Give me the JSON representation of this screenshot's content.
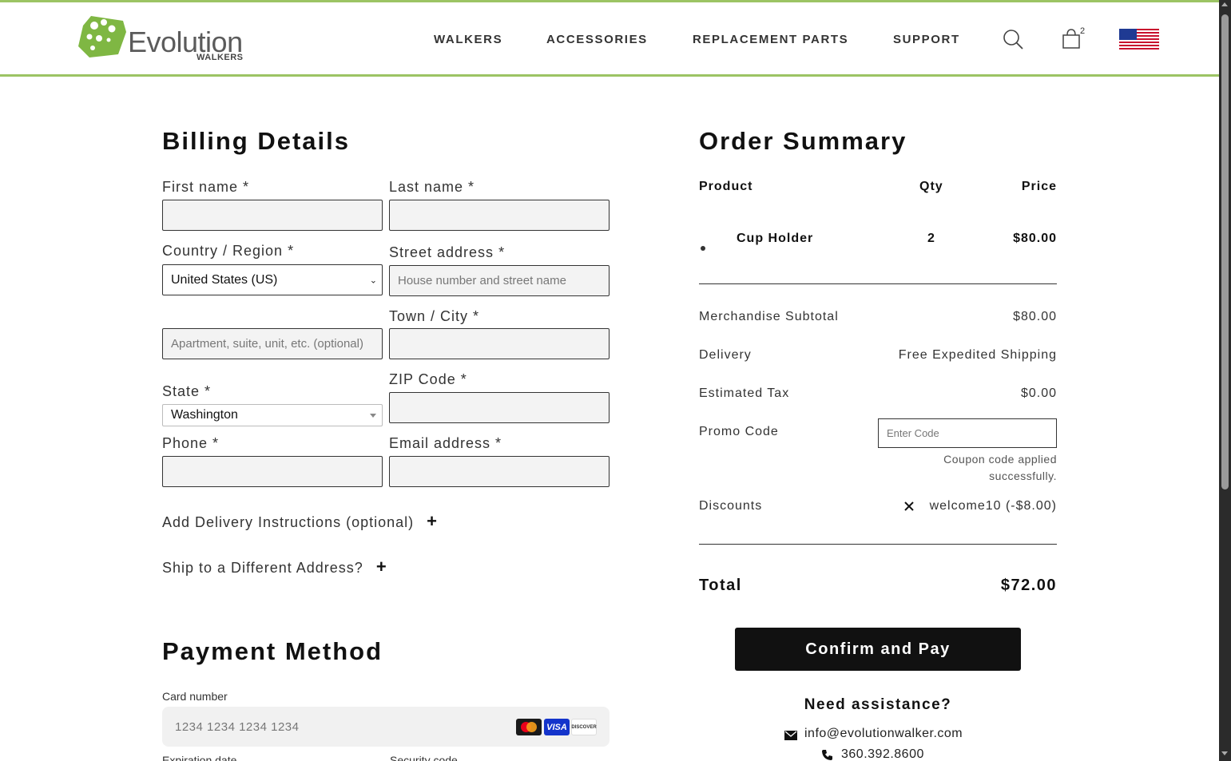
{
  "brand": {
    "name": "Evolution",
    "subtitle": "WALKERS",
    "accent_color": "#9cc464"
  },
  "nav": {
    "items": [
      "WALKERS",
      "ACCESSORIES",
      "REPLACEMENT PARTS",
      "SUPPORT"
    ],
    "cart_count": "2",
    "search_icon": "search-icon",
    "cart_icon": "shopping-bag-icon",
    "flag_icon": "us-flag-icon"
  },
  "billing": {
    "title": "Billing Details",
    "first_name_label": "First name *",
    "last_name_label": "Last name *",
    "country_label": "Country / Region *",
    "country_value": "United States (US)",
    "street_label": "Street address *",
    "street_placeholder": "House number and street name",
    "apt_placeholder": "Apartment, suite, unit, etc. (optional)",
    "city_label": "Town / City *",
    "state_label": "State *",
    "state_value": "Washington",
    "zip_label": "ZIP Code *",
    "phone_label": "Phone *",
    "email_label": "Email address *",
    "delivery_instructions": "Add Delivery Instructions (optional)",
    "ship_different": "Ship to a Different Address?"
  },
  "payment": {
    "title": "Payment Method",
    "card_label": "Card number",
    "card_placeholder": "1234 1234 1234 1234",
    "card_brands": [
      "mastercard-icon",
      "visa-icon",
      "discover-icon"
    ],
    "visa_text": "VISA",
    "discover_text": "DISCOVER",
    "expiry_label": "Expiration date",
    "cvc_label": "Security code"
  },
  "summary": {
    "title": "Order Summary",
    "headers": {
      "product": "Product",
      "qty": "Qty",
      "price": "Price"
    },
    "items": [
      {
        "name": "Cup Holder",
        "qty": "2",
        "price": "$80.00"
      }
    ],
    "subtotal_label": "Merchandise Subtotal",
    "subtotal_value": "$80.00",
    "delivery_label": "Delivery",
    "delivery_value": "Free Expedited Shipping",
    "tax_label": "Estimated Tax",
    "tax_value": "$0.00",
    "promo_label": "Promo Code",
    "promo_placeholder": "Enter Code",
    "coupon_msg_1": "Coupon code applied",
    "coupon_msg_2": "successfully.",
    "discounts_label": "Discounts",
    "discount_value": "welcome10 (-$8.00)",
    "total_label": "Total",
    "total_value": "$72.00",
    "confirm_label": "Confirm and Pay",
    "need_help": "Need assistance?",
    "email": "info@evolutionwalker.com",
    "phone": "360.392.8600"
  }
}
